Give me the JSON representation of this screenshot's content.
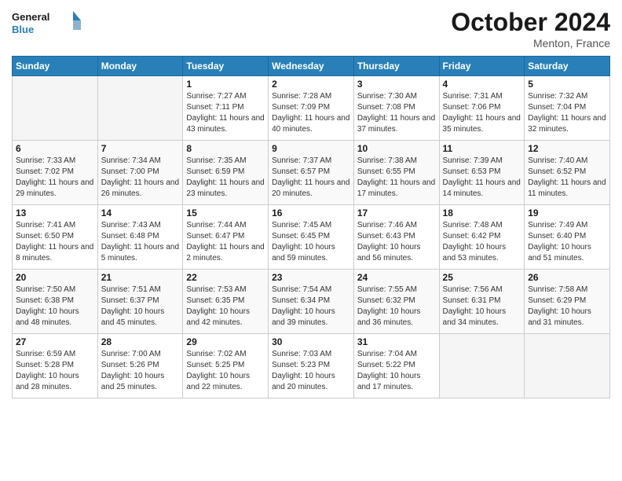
{
  "header": {
    "logo_line1": "General",
    "logo_line2": "Blue",
    "month_title": "October 2024",
    "subtitle": "Menton, France"
  },
  "weekdays": [
    "Sunday",
    "Monday",
    "Tuesday",
    "Wednesday",
    "Thursday",
    "Friday",
    "Saturday"
  ],
  "weeks": [
    [
      {
        "day": "",
        "empty": true
      },
      {
        "day": "",
        "empty": true
      },
      {
        "day": "1",
        "sunrise": "7:27 AM",
        "sunset": "7:11 PM",
        "daylight": "11 hours and 43 minutes."
      },
      {
        "day": "2",
        "sunrise": "7:28 AM",
        "sunset": "7:09 PM",
        "daylight": "11 hours and 40 minutes."
      },
      {
        "day": "3",
        "sunrise": "7:30 AM",
        "sunset": "7:08 PM",
        "daylight": "11 hours and 37 minutes."
      },
      {
        "day": "4",
        "sunrise": "7:31 AM",
        "sunset": "7:06 PM",
        "daylight": "11 hours and 35 minutes."
      },
      {
        "day": "5",
        "sunrise": "7:32 AM",
        "sunset": "7:04 PM",
        "daylight": "11 hours and 32 minutes."
      }
    ],
    [
      {
        "day": "6",
        "sunrise": "7:33 AM",
        "sunset": "7:02 PM",
        "daylight": "11 hours and 29 minutes."
      },
      {
        "day": "7",
        "sunrise": "7:34 AM",
        "sunset": "7:00 PM",
        "daylight": "11 hours and 26 minutes."
      },
      {
        "day": "8",
        "sunrise": "7:35 AM",
        "sunset": "6:59 PM",
        "daylight": "11 hours and 23 minutes."
      },
      {
        "day": "9",
        "sunrise": "7:37 AM",
        "sunset": "6:57 PM",
        "daylight": "11 hours and 20 minutes."
      },
      {
        "day": "10",
        "sunrise": "7:38 AM",
        "sunset": "6:55 PM",
        "daylight": "11 hours and 17 minutes."
      },
      {
        "day": "11",
        "sunrise": "7:39 AM",
        "sunset": "6:53 PM",
        "daylight": "11 hours and 14 minutes."
      },
      {
        "day": "12",
        "sunrise": "7:40 AM",
        "sunset": "6:52 PM",
        "daylight": "11 hours and 11 minutes."
      }
    ],
    [
      {
        "day": "13",
        "sunrise": "7:41 AM",
        "sunset": "6:50 PM",
        "daylight": "11 hours and 8 minutes."
      },
      {
        "day": "14",
        "sunrise": "7:43 AM",
        "sunset": "6:48 PM",
        "daylight": "11 hours and 5 minutes."
      },
      {
        "day": "15",
        "sunrise": "7:44 AM",
        "sunset": "6:47 PM",
        "daylight": "11 hours and 2 minutes."
      },
      {
        "day": "16",
        "sunrise": "7:45 AM",
        "sunset": "6:45 PM",
        "daylight": "10 hours and 59 minutes."
      },
      {
        "day": "17",
        "sunrise": "7:46 AM",
        "sunset": "6:43 PM",
        "daylight": "10 hours and 56 minutes."
      },
      {
        "day": "18",
        "sunrise": "7:48 AM",
        "sunset": "6:42 PM",
        "daylight": "10 hours and 53 minutes."
      },
      {
        "day": "19",
        "sunrise": "7:49 AM",
        "sunset": "6:40 PM",
        "daylight": "10 hours and 51 minutes."
      }
    ],
    [
      {
        "day": "20",
        "sunrise": "7:50 AM",
        "sunset": "6:38 PM",
        "daylight": "10 hours and 48 minutes."
      },
      {
        "day": "21",
        "sunrise": "7:51 AM",
        "sunset": "6:37 PM",
        "daylight": "10 hours and 45 minutes."
      },
      {
        "day": "22",
        "sunrise": "7:53 AM",
        "sunset": "6:35 PM",
        "daylight": "10 hours and 42 minutes."
      },
      {
        "day": "23",
        "sunrise": "7:54 AM",
        "sunset": "6:34 PM",
        "daylight": "10 hours and 39 minutes."
      },
      {
        "day": "24",
        "sunrise": "7:55 AM",
        "sunset": "6:32 PM",
        "daylight": "10 hours and 36 minutes."
      },
      {
        "day": "25",
        "sunrise": "7:56 AM",
        "sunset": "6:31 PM",
        "daylight": "10 hours and 34 minutes."
      },
      {
        "day": "26",
        "sunrise": "7:58 AM",
        "sunset": "6:29 PM",
        "daylight": "10 hours and 31 minutes."
      }
    ],
    [
      {
        "day": "27",
        "sunrise": "6:59 AM",
        "sunset": "5:28 PM",
        "daylight": "10 hours and 28 minutes."
      },
      {
        "day": "28",
        "sunrise": "7:00 AM",
        "sunset": "5:26 PM",
        "daylight": "10 hours and 25 minutes."
      },
      {
        "day": "29",
        "sunrise": "7:02 AM",
        "sunset": "5:25 PM",
        "daylight": "10 hours and 22 minutes."
      },
      {
        "day": "30",
        "sunrise": "7:03 AM",
        "sunset": "5:23 PM",
        "daylight": "10 hours and 20 minutes."
      },
      {
        "day": "31",
        "sunrise": "7:04 AM",
        "sunset": "5:22 PM",
        "daylight": "10 hours and 17 minutes."
      },
      {
        "day": "",
        "empty": true
      },
      {
        "day": "",
        "empty": true
      }
    ]
  ]
}
